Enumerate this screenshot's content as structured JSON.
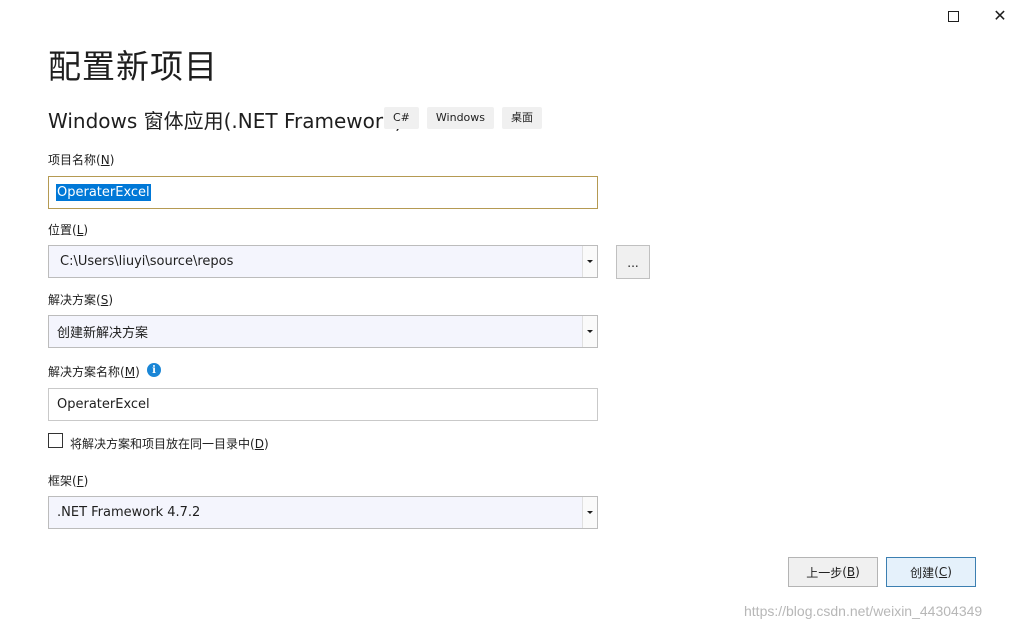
{
  "window": {
    "maximize_icon": "maximize-icon",
    "close_icon": "close-icon",
    "close_glyph": "✕"
  },
  "page": {
    "title": "配置新项目",
    "template_name": "Windows 窗体应用(.NET Framework)",
    "tags": [
      "C#",
      "Windows",
      "桌面"
    ]
  },
  "project_name": {
    "label": "项目名称",
    "mnemonic": "N",
    "value": "OperaterExcel"
  },
  "location": {
    "label": "位置",
    "mnemonic": "L",
    "value": "C:\\Users\\liuyi\\source\\repos",
    "browse_label": "..."
  },
  "solution": {
    "label": "解决方案",
    "mnemonic": "S",
    "value": "创建新解决方案"
  },
  "solution_name": {
    "label": "解决方案名称",
    "mnemonic": "M",
    "value": "OperaterExcel",
    "info_glyph": "i"
  },
  "same_dir": {
    "label": "将解决方案和项目放在同一目录中",
    "mnemonic": "D",
    "checked": false
  },
  "framework": {
    "label": "框架",
    "mnemonic": "F",
    "value": ".NET Framework 4.7.2"
  },
  "buttons": {
    "back_label": "上一步",
    "back_mnemonic": "B",
    "create_label": "创建",
    "create_mnemonic": "C"
  },
  "watermark": "https://blog.csdn.net/weixin_44304349",
  "colors": {
    "accent": "#0078d7",
    "focus_border": "#b59a52",
    "info": "#1a86d6"
  }
}
